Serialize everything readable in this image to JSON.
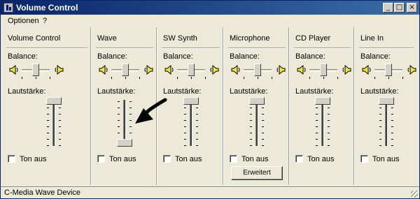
{
  "window": {
    "title": "Volume Control",
    "icon": "volume-control-app-icon",
    "caption_buttons": {
      "minimize": "_",
      "maximize": "□",
      "close": "×"
    }
  },
  "menu": [
    "Optionen",
    "?"
  ],
  "labels": {
    "balance": "Balance:",
    "volume": "Lautstärke:",
    "mute": "Ton aus"
  },
  "columns": [
    {
      "title": "Volume Control",
      "volume_level": 1.0,
      "balance": 0.0,
      "muted": false
    },
    {
      "title": "Wave",
      "volume_level": 0.0,
      "balance": 0.0,
      "muted": false
    },
    {
      "title": "SW Synth",
      "volume_level": 1.0,
      "balance": 0.0,
      "muted": false
    },
    {
      "title": "Microphone",
      "volume_level": 1.0,
      "balance": 0.0,
      "muted": false,
      "advanced_label": "Erweitert"
    },
    {
      "title": "CD Player",
      "volume_level": 1.0,
      "balance": 0.0,
      "muted": false
    },
    {
      "title": "Line In",
      "volume_level": 1.0,
      "balance": 0.0,
      "muted": false
    }
  ],
  "status": "C-Media Wave Device",
  "annotation": {
    "type": "arrow",
    "points_to": "Wave volume slider",
    "color": "#000000"
  },
  "colors": {
    "titlebar_start": "#0a246a",
    "titlebar_end": "#3a6ea5",
    "face": "#ece9d8",
    "speaker": "#f2e642"
  }
}
